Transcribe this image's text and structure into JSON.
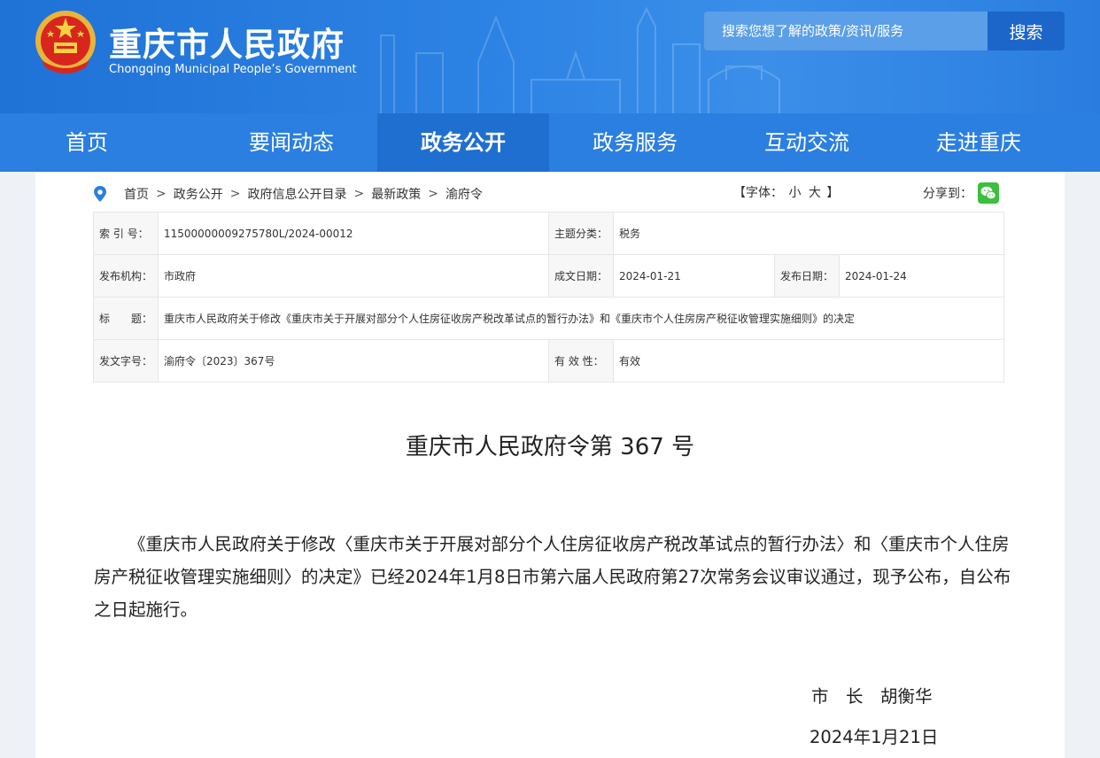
{
  "header": {
    "title": "重庆市人民政府",
    "subtitle": "Chongqing Municipal People’s Government",
    "search_placeholder": "搜索您想了解的政策/资讯/服务",
    "search_button": "搜索"
  },
  "nav": {
    "items": [
      "首页",
      "要闻动态",
      "政务公开",
      "政务服务",
      "互动交流",
      "走进重庆"
    ],
    "active": "政务公开"
  },
  "breadcrumb": {
    "items": [
      "首页",
      "政务公开",
      "政府信息公开目录",
      "最新政策",
      "渝府令"
    ],
    "separator": ">"
  },
  "font_size": {
    "open": "【字体：",
    "small": "小",
    "large": "大",
    "close": "】"
  },
  "share": {
    "label": "分享到："
  },
  "info": {
    "index_label": "索 引 号：",
    "index_value": "11500000009275780L/2024-00012",
    "topic_label": "主题分类：",
    "topic_value": "税务",
    "publisher_label": "发布机构：",
    "publisher_value": "市政府",
    "written_label": "成文日期：",
    "written_value": "2024-01-21",
    "published_label": "发布日期：",
    "published_value": "2024-01-24",
    "title_label": "标　　题：",
    "title_value": "重庆市人民政府关于修改《重庆市关于开展对部分个人住房征收房产税改革试点的暂行办法》和《重庆市个人住房房产税征收管理实施细则》的决定",
    "doc_no_label": "发文字号：",
    "doc_no_value": "渝府令〔2023〕367号",
    "validity_label": "有 效 性：",
    "validity_value": "有效"
  },
  "article": {
    "title": "重庆市人民政府令第  367  号",
    "body": "《重庆市人民政府关于修改〈重庆市关于开展对部分个人住房征收房产税改革试点的暂行办法〉和〈重庆市个人住房房产税征收管理实施细则〉的决定》已经2024年1月8日市第六届人民政府第27次常务会议审议通过，现予公布，自公布之日起施行。",
    "signature": "市　长　胡衡华",
    "date": "2024年1月21日"
  },
  "colors": {
    "header_blue": "#2d83e4",
    "nav_active": "#1f6fd0",
    "search_button": "#1c66c9",
    "wechat_green": "#3cbf3c"
  }
}
